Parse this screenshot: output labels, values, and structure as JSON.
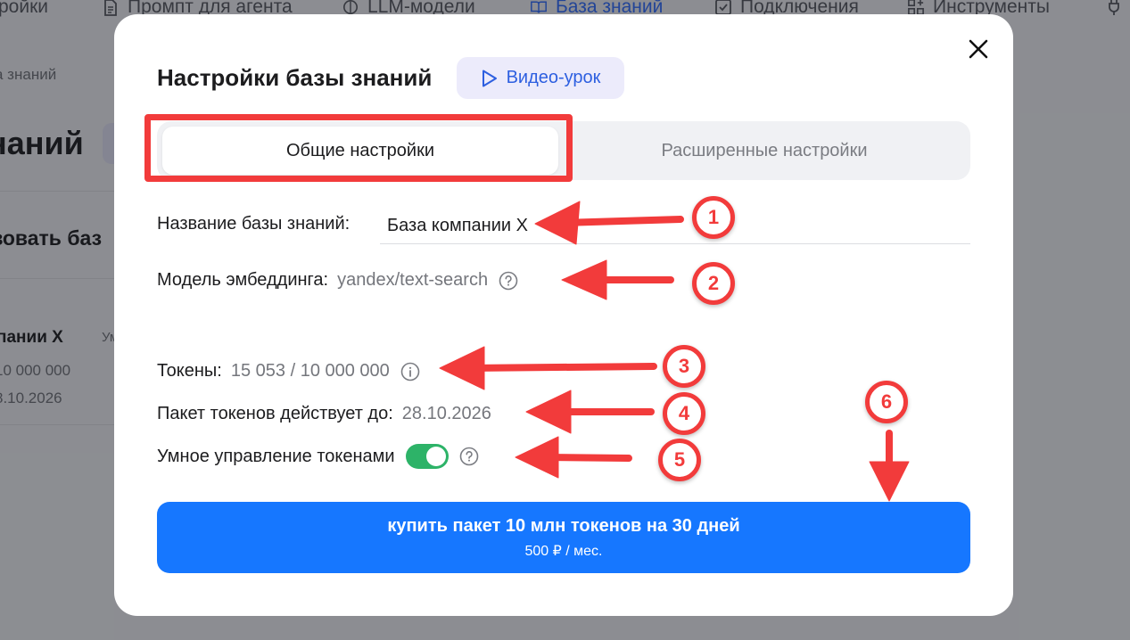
{
  "nav": {
    "items": [
      {
        "label": "ройки",
        "icon": "none"
      },
      {
        "label": "Промпт для агента",
        "icon": "document-icon"
      },
      {
        "label": "LLM-модели",
        "icon": "brain-icon"
      },
      {
        "label": "База знаний",
        "icon": "book-icon"
      },
      {
        "label": "Подключения",
        "icon": "checkbox-icon"
      },
      {
        "label": "Инструменты",
        "icon": "blocks-icon"
      }
    ]
  },
  "background": {
    "breadcrumb": "а знаний",
    "title": "наний",
    "use_text": "зовать баз",
    "kb_name": "пании X",
    "kb_um": "Ум",
    "kb_tokens": "10 000 000",
    "kb_date": "8.10.2026"
  },
  "modal": {
    "title": "Настройки базы знаний",
    "video_label": "Видео-урок",
    "tabs": [
      "Общие настройки",
      "Расширенные настройки"
    ],
    "name_label": "Название базы знаний:",
    "name_value": "База компании X",
    "embedding_label": "Модель эмбеддинга:",
    "embedding_value": "yandex/text-search",
    "tokens_label": "Токены:",
    "tokens_value": "15 053 / 10 000 000",
    "package_label": "Пакет токенов действует до:",
    "package_value": "28.10.2026",
    "smart_label": "Умное управление токенами",
    "smart_enabled": true,
    "buy_main": "купить пакет 10 млн токенов на 30 дней",
    "buy_sub": "500 ₽ / мес."
  },
  "annotations": {
    "color": "#f23b3b",
    "badges": [
      "1",
      "2",
      "3",
      "4",
      "5",
      "6"
    ]
  },
  "colors": {
    "accent": "#1677ff",
    "toggle_on": "#2db368",
    "video_bg": "#ecebfb"
  }
}
